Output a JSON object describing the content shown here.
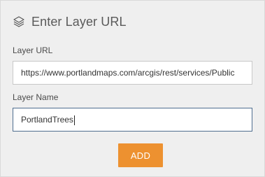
{
  "header": {
    "title": "Enter Layer URL",
    "icon": "layers-icon"
  },
  "layer_url": {
    "label": "Layer URL",
    "value": "https://www.portlandmaps.com/arcgis/rest/services/Public"
  },
  "layer_name": {
    "label": "Layer Name",
    "value": "PortlandTrees"
  },
  "add_button": {
    "label": "ADD"
  },
  "colors": {
    "accent": "#ed9130",
    "panel_bg": "#efefef",
    "focus_border": "#4f6d8f"
  }
}
